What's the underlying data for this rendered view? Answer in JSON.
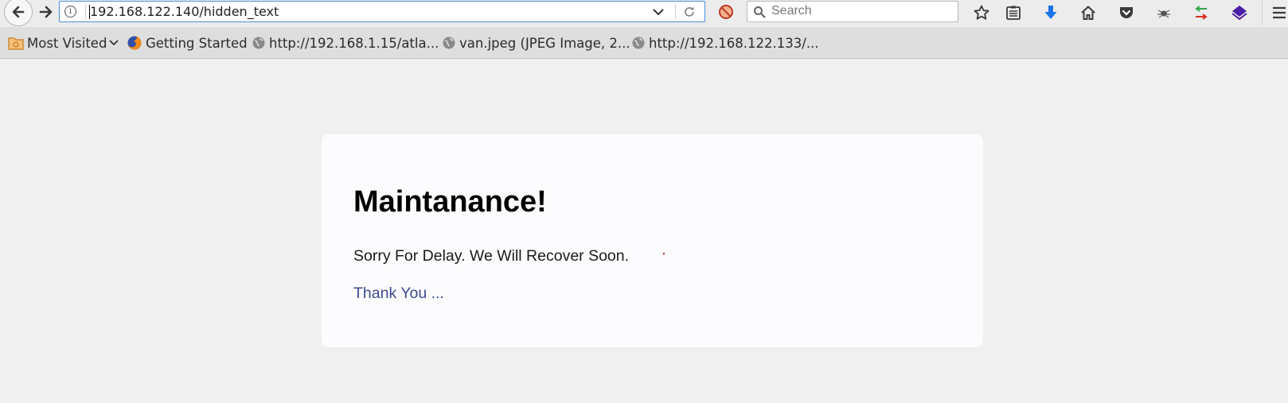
{
  "browser": {
    "url": "192.168.122.140/hidden_text",
    "search_placeholder": "Search"
  },
  "toolbar_icons": [
    "back-arrow-icon",
    "forward-arrow-icon",
    "info-icon",
    "dropdown-icon",
    "reload-icon",
    "ublock-icon",
    "search-icon",
    "bookmark-star-icon",
    "reading-list-icon",
    "download-icon",
    "home-icon",
    "pocket-icon",
    "bug-icon",
    "sync-arrows-icon",
    "layers-icon",
    "menu-icon"
  ],
  "bookmarks": {
    "items": [
      {
        "label": "Most Visited",
        "icon": "folder-icon"
      },
      {
        "label": "Getting Started",
        "icon": "firefox-icon"
      },
      {
        "label": "http://192.168.1.15/atla...",
        "icon": "globe-icon"
      },
      {
        "label": "van.jpeg (JPEG Image, 2...",
        "icon": "globe-icon"
      },
      {
        "label": "http://192.168.122.133/...",
        "icon": "globe-icon"
      }
    ]
  },
  "page": {
    "heading": "Maintanance!",
    "message": "Sorry For Delay. We Will Recover Soon.",
    "thanks": "Thank You ..."
  },
  "colors": {
    "page_background": "#f0f0f1",
    "card_background": "#fcfcfe",
    "link_color": "#3d4a8c",
    "download_blue": "#1a73e8",
    "layers_purple": "#4b1ea6"
  }
}
